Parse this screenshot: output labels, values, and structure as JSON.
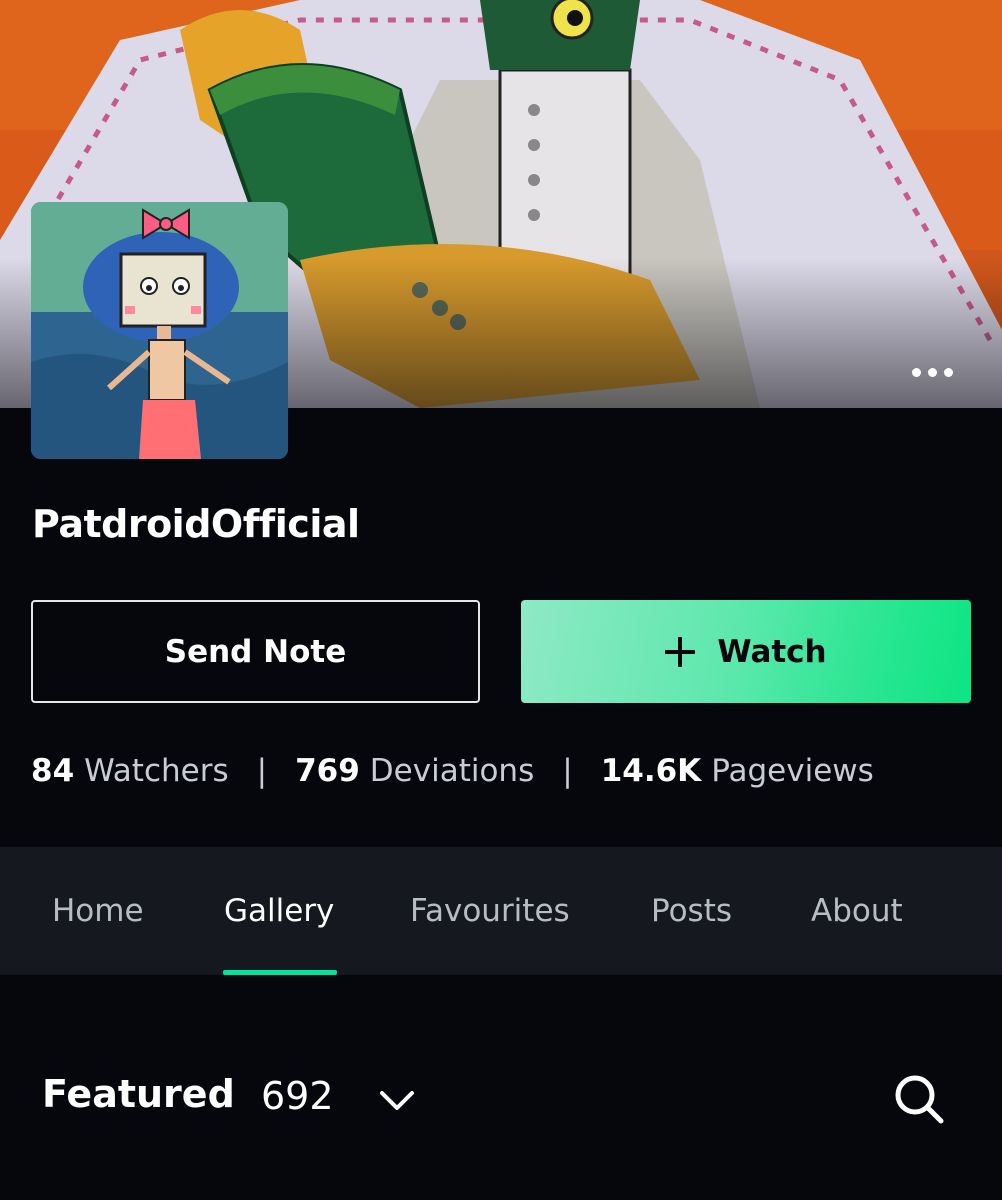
{
  "profile": {
    "username": "PatdroidOfficial",
    "cover_icon": "cover-artwork",
    "avatar_icon": "avatar-artwork"
  },
  "actions": {
    "send_note_label": "Send Note",
    "watch_label": "Watch",
    "watch_icon": "plus-icon",
    "more_icon": "more-horizontal-icon"
  },
  "stats": [
    {
      "value": "84",
      "label": "Watchers"
    },
    {
      "value": "769",
      "label": "Deviations"
    },
    {
      "value": "14.6K",
      "label": "Pageviews"
    }
  ],
  "stat_separator": "|",
  "tabs": [
    {
      "label": "Home",
      "active": false
    },
    {
      "label": "Gallery",
      "active": true
    },
    {
      "label": "Favourites",
      "active": false
    },
    {
      "label": "Posts",
      "active": false
    },
    {
      "label": "About",
      "active": false
    }
  ],
  "gallery": {
    "folder_label": "Featured",
    "folder_count": "692",
    "dropdown_icon": "chevron-down-icon",
    "search_icon": "search-icon"
  },
  "colors": {
    "background": "#06070d",
    "tab_bar": "#15181f",
    "accent": "#00e59b",
    "watch_gradient_start": "#8ee9c4",
    "watch_gradient_end": "#12e584"
  }
}
